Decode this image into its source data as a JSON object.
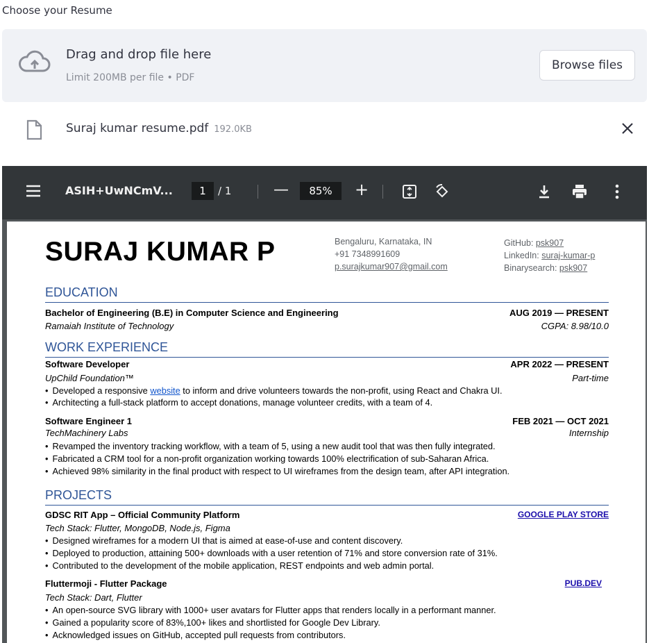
{
  "uploader": {
    "label": "Choose your Resume",
    "drop_title": "Drag and drop file here",
    "drop_subtitle": "Limit 200MB per file • PDF",
    "browse_label": "Browse files"
  },
  "file": {
    "name": "Suraj kumar resume.pdf",
    "size": "192.0KB"
  },
  "viewer": {
    "doc_title": "ASIH+UwNCmV...",
    "page_current": "1",
    "page_total": "/  1",
    "zoom": "85%",
    "minus": "—",
    "plus": "+"
  },
  "resume": {
    "name": "SURAJ KUMAR P",
    "contact_left": [
      "Bengaluru, Karnataka, IN",
      "+91 7348991609",
      "p.surajkumar907@gmail.com"
    ],
    "github_label": "GitHub: ",
    "github_value": "psk907",
    "linkedin_label": "LinkedIn: ",
    "linkedin_value": "suraj-kumar-p",
    "binary_label": "Binarysearch: ",
    "binary_value": "psk907",
    "education": {
      "heading": "EDUCATION",
      "degree": "Bachelor of Engineering (B.E) in Computer Science and Engineering",
      "dates": "AUG 2019 — PRESENT",
      "school": "Ramaiah Institute of Technology",
      "cgpa": "CGPA: 8.98/10.0"
    },
    "work": {
      "heading": "WORK EXPERIENCE",
      "job1": {
        "title": "Software Developer",
        "dates": "APR 2022 — PRESENT",
        "org": "UpChild Foundation™",
        "kind": "Part-time",
        "b1_pre": "Developed a responsive ",
        "b1_link": "website",
        "b1_post": " to inform and drive volunteers towards the non-profit, using React and Chakra UI.",
        "b2": "Architecting a full-stack platform to accept donations, manage volunteer credits, with a team of 4."
      },
      "job2": {
        "title": "Software Engineer 1",
        "dates": "FEB 2021 — OCT 2021",
        "org": "TechMachinery Labs",
        "kind": "Internship",
        "b1": "Revamped the inventory tracking workflow, with a team of 5, using a new audit tool that was then fully integrated.",
        "b2": "Fabricated a CRM tool for a non-profit organization working towards 100% electrification of sub-Saharan Africa.",
        "b3": "Achieved 98% similarity in the final product with respect to UI wireframes from the design team, after API integration."
      }
    },
    "projects": {
      "heading": "PROJECTS",
      "p1": {
        "title": "GDSC RIT App – Official Community Platform",
        "link": "GOOGLE PLAY STORE",
        "stack": "Tech Stack: Flutter, MongoDB, Node.js, Figma",
        "b1": "Designed wireframes for a modern UI that is aimed at ease-of-use and content discovery.",
        "b2": "Deployed to production, attaining 500+ downloads with a user retention of 71% and store conversion rate of 31%.",
        "b3": "Contributed to the development of the mobile application, REST endpoints and web admin portal."
      },
      "p2": {
        "title": "Fluttermoji - Flutter Package",
        "link": "PUB.DEV",
        "stack": "Tech Stack: Dart, Flutter",
        "b1": "An open-source SVG library with 1000+ user avatars for Flutter apps that renders locally in a performant manner.",
        "b2": "Gained a popularity score of 83%,100+ likes and shortlisted for Google Dev Library.",
        "b3": "Acknowledged issues on GitHub, accepted pull requests from contributors."
      }
    }
  },
  "colors": {
    "accent": "#2f5597",
    "toolbar": "#323639",
    "dropzone": "#f0f2f6"
  },
  "icons": [
    "cloud-upload-icon",
    "file-icon",
    "close-icon",
    "menu-icon",
    "fit-page-icon",
    "rotate-icon",
    "download-icon",
    "print-icon",
    "more-vert-icon"
  ]
}
